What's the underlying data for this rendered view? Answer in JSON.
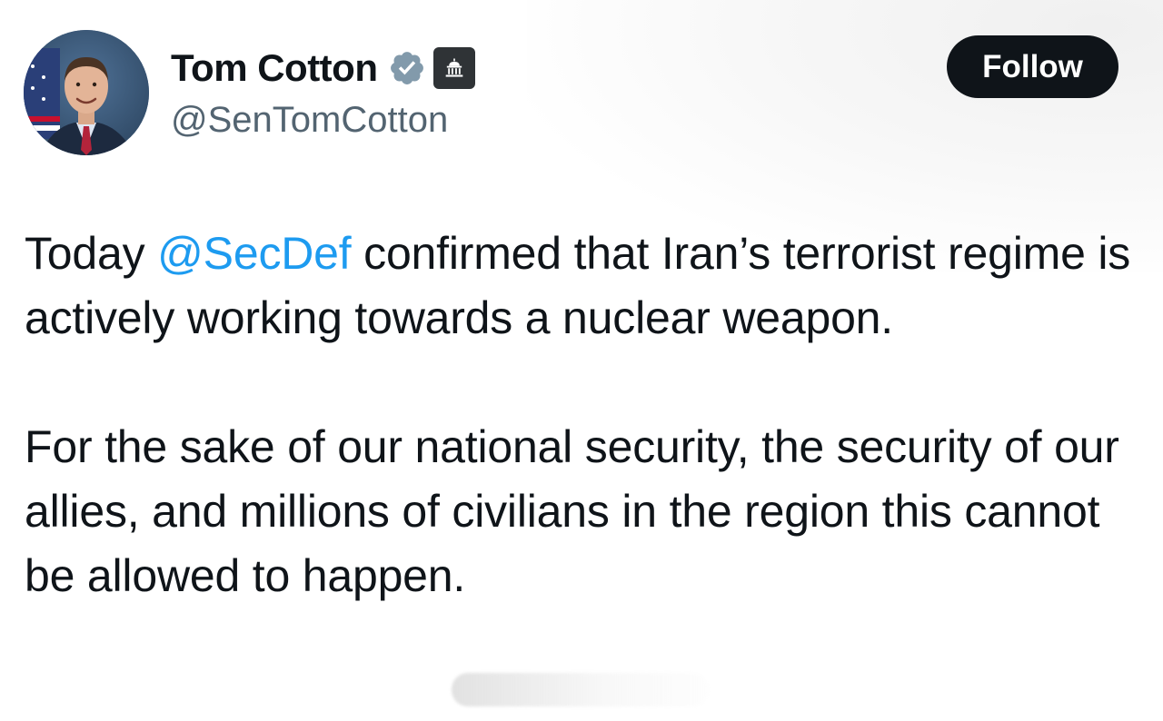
{
  "author": {
    "display_name": "Tom Cotton",
    "handle": "@SenTomCotton",
    "verified_badge_color": "#829aab",
    "affiliation_badge_bg": "#2f3336"
  },
  "actions": {
    "follow_label": "Follow"
  },
  "tweet": {
    "para1_before": "Today ",
    "mention": "@SecDef",
    "para1_after": " confirmed that Iran’s terrorist regime is actively working towards a nuclear weapon.",
    "para2": "For the sake of our national security, the security of our allies, and millions of civilians in the region this cannot be allowed to happen."
  },
  "colors": {
    "text": "#0f1419",
    "secondary_text": "#536471",
    "link": "#1d9bf0",
    "button_bg": "#0f1419",
    "button_text": "#ffffff"
  },
  "icons": {
    "verified": "verified-check-icon",
    "affiliation": "government-building-icon"
  }
}
